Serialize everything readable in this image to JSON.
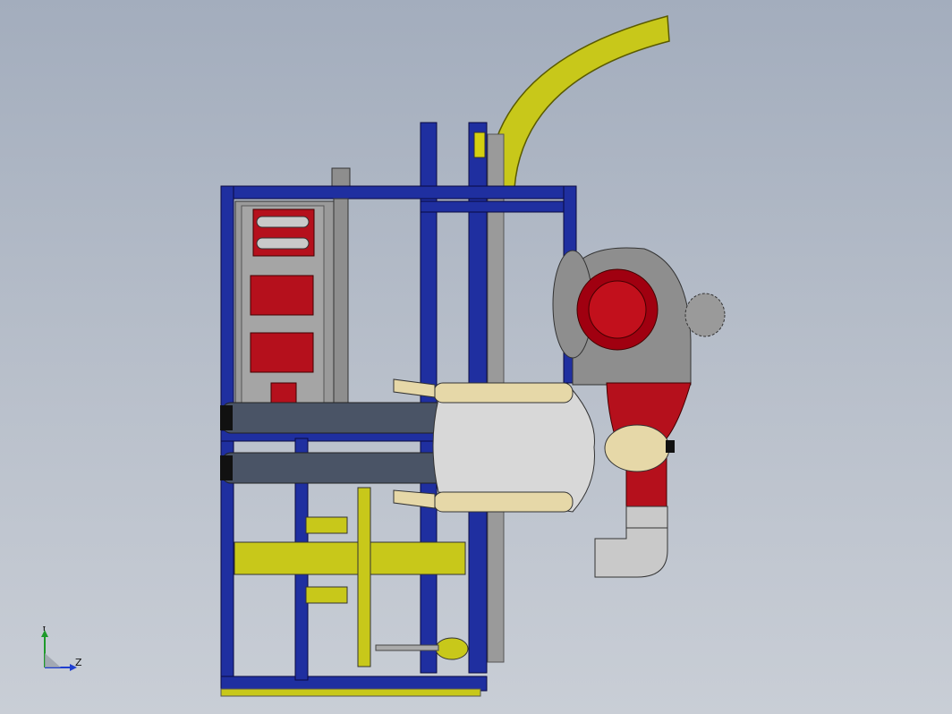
{
  "view": {
    "background_top": "#a3adbd",
    "background_bottom": "#c9ced6",
    "frame_color": "#1f2fa0",
    "rail_color": "#c8c81a",
    "cabinet_red": "#b5101c",
    "metal_grey": "#8e8e8e"
  },
  "triad": {
    "y_label": "Y",
    "z_label": "Z",
    "y_color": "#1e9a2a",
    "z_color": "#1f3fd0"
  }
}
